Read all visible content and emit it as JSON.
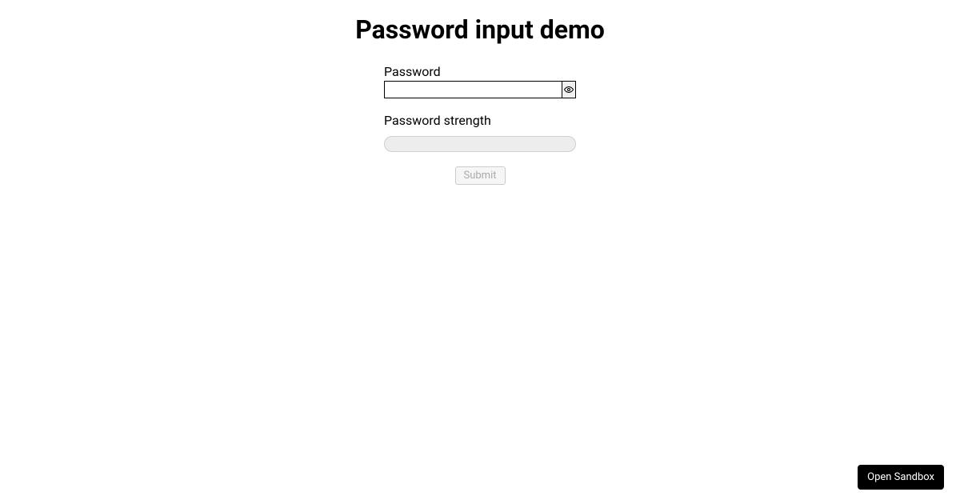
{
  "page": {
    "title": "Password input demo"
  },
  "form": {
    "password_label": "Password",
    "password_value": "",
    "password_placeholder": "",
    "toggle_icon_name": "eye-icon",
    "strength_label": "Password strength",
    "strength_value": 0,
    "strength_max": 100,
    "submit_label": "Submit",
    "submit_disabled": true
  },
  "footer": {
    "open_sandbox_label": "Open Sandbox"
  }
}
